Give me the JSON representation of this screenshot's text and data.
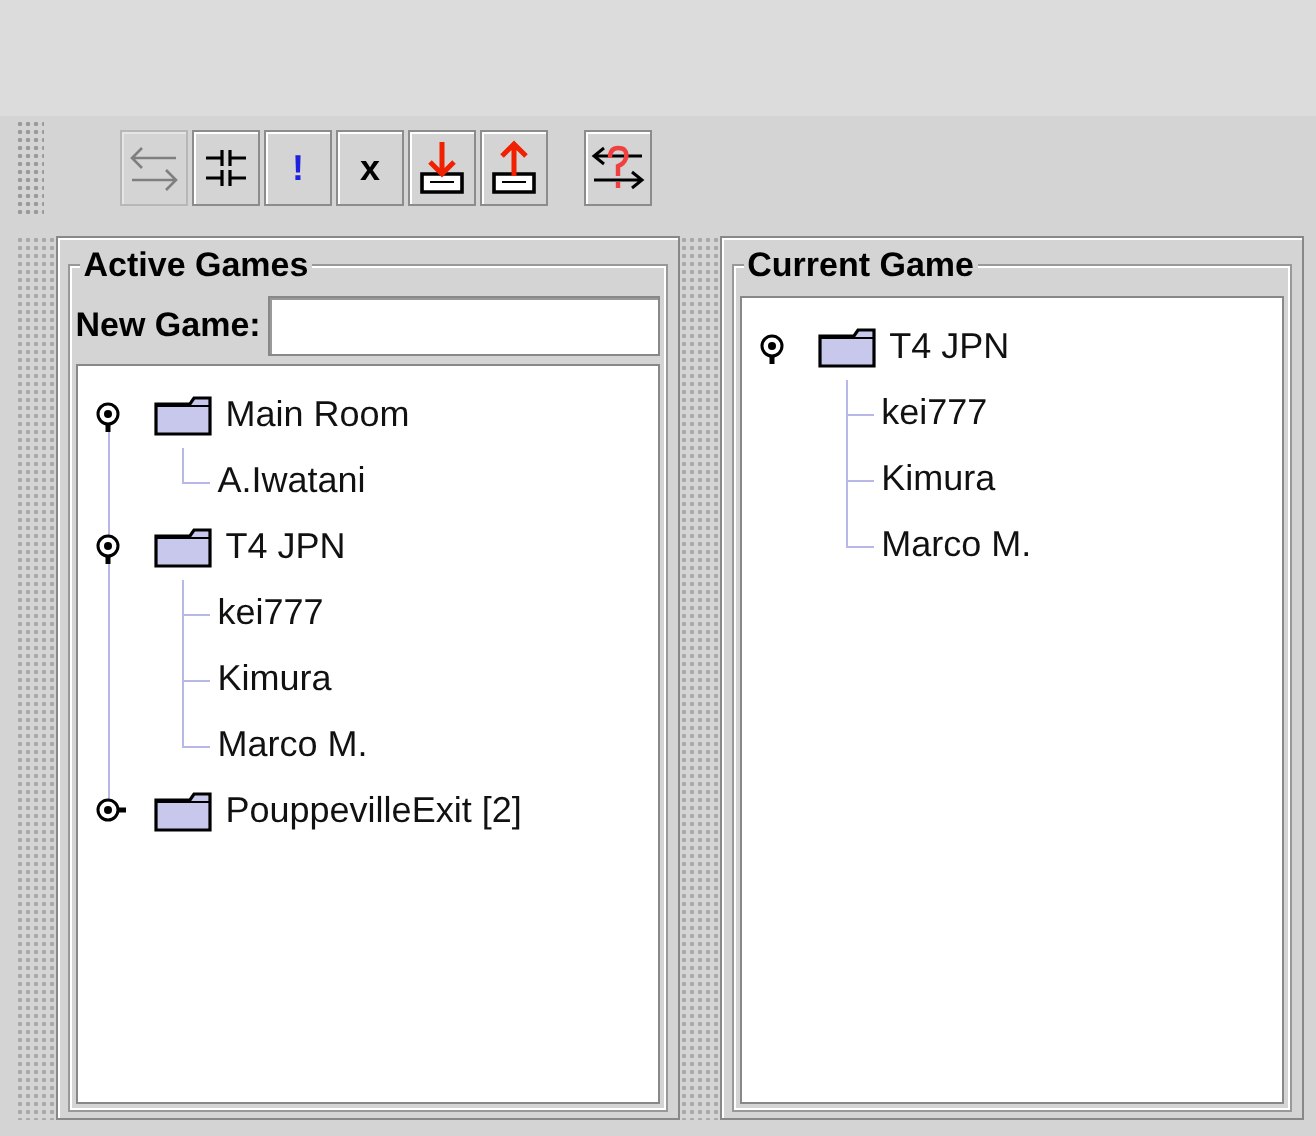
{
  "toolbar_groups": [
    [
      {
        "kind": "swap",
        "disabled": true
      },
      {
        "kind": "disconnect",
        "disabled": false
      },
      {
        "kind": "text",
        "label": "!",
        "disabled": false
      },
      {
        "kind": "text",
        "label": "x",
        "disabled": false
      },
      {
        "kind": "download",
        "disabled": false
      },
      {
        "kind": "upload",
        "disabled": false
      }
    ],
    [
      {
        "kind": "help-swap",
        "disabled": false
      }
    ]
  ],
  "active_games": {
    "title": "Active Games",
    "new_game_label": "New Game:",
    "tree": [
      {
        "label": "Main Room",
        "expanded": true,
        "children": [
          {
            "label": "A.Iwatani"
          }
        ]
      },
      {
        "label": "T4 JPN",
        "expanded": true,
        "children": [
          {
            "label": "kei777"
          },
          {
            "label": "Kimura"
          },
          {
            "label": "Marco M."
          }
        ]
      },
      {
        "label": "PouppevilleExit [2]",
        "expanded": false
      }
    ]
  },
  "current_game": {
    "title": "Current Game",
    "tree": [
      {
        "label": "T4 JPN",
        "expanded": true,
        "children": [
          {
            "label": "kei777"
          },
          {
            "label": "Kimura"
          },
          {
            "label": "Marco M."
          }
        ]
      }
    ]
  }
}
